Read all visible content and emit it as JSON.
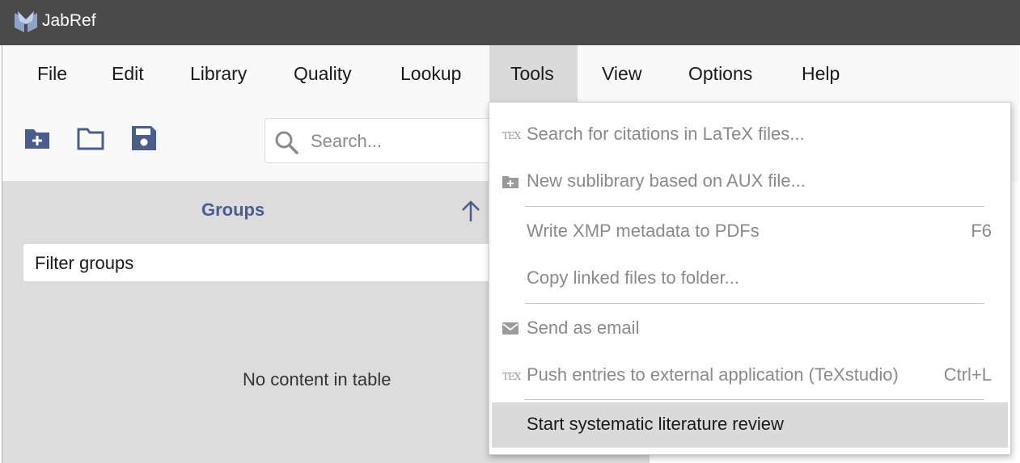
{
  "app": {
    "title": "JabRef"
  },
  "menubar": {
    "items": [
      {
        "label": "File"
      },
      {
        "label": "Edit"
      },
      {
        "label": "Library"
      },
      {
        "label": "Quality"
      },
      {
        "label": "Lookup"
      },
      {
        "label": "Tools",
        "active": true
      },
      {
        "label": "View"
      },
      {
        "label": "Options"
      },
      {
        "label": "Help"
      }
    ]
  },
  "toolbar": {
    "icons": [
      "new-library-icon",
      "open-folder-icon",
      "save-icon"
    ],
    "search_placeholder": "Search..."
  },
  "groups": {
    "title": "Groups",
    "filter_placeholder": "Filter groups",
    "empty_message": "No content in table"
  },
  "tools_menu": {
    "items": [
      {
        "label": "Search for citations in LaTeX files...",
        "icon": "tex-icon",
        "enabled": false
      },
      {
        "label": "New sublibrary based on AUX file...",
        "icon": "folder-plus-icon",
        "enabled": false
      },
      {
        "label": "Write XMP metadata to PDFs",
        "accelerator": "F6",
        "enabled": false
      },
      {
        "label": "Copy linked files to folder...",
        "enabled": false
      },
      {
        "label": "Send as email",
        "icon": "email-icon",
        "enabled": false
      },
      {
        "label": "Push entries to external application (TeXstudio)",
        "accelerator": "Ctrl+L",
        "icon": "tex-icon",
        "enabled": false
      },
      {
        "label": "Start systematic literature review",
        "enabled": true,
        "highlighted": true
      }
    ]
  },
  "colors": {
    "titlebar": "#4a4a4a",
    "accent": "#4a5e8e",
    "menu_active": "#dadada",
    "disabled_text": "#8a8a8a"
  }
}
